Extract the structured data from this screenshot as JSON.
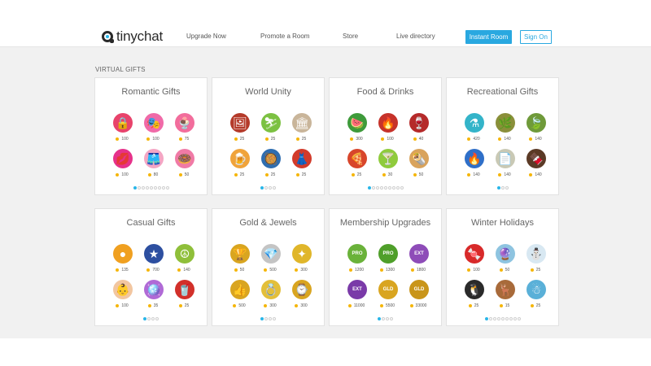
{
  "header": {
    "logo_text": "tinychat",
    "nav": [
      "Upgrade Now",
      "Promote a Room",
      "Store",
      "Live directory"
    ],
    "instant_room": "Instant Room",
    "sign_on": "Sign On"
  },
  "section_title": "VIRTUAL GIFTS",
  "colors": {
    "accent": "#29a8e0",
    "coin": "#f5b60a",
    "background": "#f1f1f1"
  },
  "cards": [
    {
      "title": "Romantic Gifts",
      "dots": 9,
      "active": 0,
      "gifts": [
        {
          "icon": "heart-lock-icon",
          "glyph": "🔒",
          "color": "#e8436b",
          "price": "100"
        },
        {
          "icon": "mask-icon",
          "glyph": "🎭",
          "color": "#f06aa8",
          "price": "100"
        },
        {
          "icon": "sundae-icon",
          "glyph": "🍨",
          "color": "#f26d9c",
          "price": "75"
        },
        {
          "icon": "lips-icon",
          "glyph": "💋",
          "color": "#e6318a",
          "price": "100"
        },
        {
          "icon": "boxers-icon",
          "glyph": "🩳",
          "color": "#f4a6c4",
          "price": "80"
        },
        {
          "icon": "donut-icon",
          "glyph": "🍩",
          "color": "#f07aa6",
          "price": "50"
        }
      ]
    },
    {
      "title": "World Unity",
      "dots": 4,
      "active": 0,
      "gifts": [
        {
          "icon": "portrait-icon",
          "glyph": "🖼",
          "color": "#b43a2a",
          "price": "25"
        },
        {
          "icon": "skier-icon",
          "glyph": "⛷",
          "color": "#7cc142",
          "price": "25"
        },
        {
          "icon": "arch-icon",
          "glyph": "🏛",
          "color": "#c9b59a",
          "price": "25"
        },
        {
          "icon": "beer-icon",
          "glyph": "🍺",
          "color": "#f0a33a",
          "price": "25"
        },
        {
          "icon": "paella-icon",
          "glyph": "🥘",
          "color": "#2e6db0",
          "price": "25"
        },
        {
          "icon": "dress-icon",
          "glyph": "👗",
          "color": "#d23b2b",
          "price": "25"
        }
      ]
    },
    {
      "title": "Food & Drinks",
      "dots": 9,
      "active": 0,
      "gifts": [
        {
          "icon": "watermelon-icon",
          "glyph": "🍉",
          "color": "#3e9a3a",
          "price": "300"
        },
        {
          "icon": "grill-icon",
          "glyph": "🔥",
          "color": "#c6322a",
          "price": "100"
        },
        {
          "icon": "sangria-icon",
          "glyph": "🍷",
          "color": "#b52a2a",
          "price": "40"
        },
        {
          "icon": "pizza-icon",
          "glyph": "🍕",
          "color": "#d8462b",
          "price": "25"
        },
        {
          "icon": "margarita-icon",
          "glyph": "🍸",
          "color": "#8fcb3c",
          "price": "30"
        },
        {
          "icon": "burrito-icon",
          "glyph": "🌯",
          "color": "#d9a35c",
          "price": "50"
        }
      ]
    },
    {
      "title": "Recreational Gifts",
      "dots": 3,
      "active": 0,
      "gifts": [
        {
          "icon": "bong-icon",
          "glyph": "⚗",
          "color": "#34b4c9",
          "price": "420"
        },
        {
          "icon": "herb-bowl-icon",
          "glyph": "🌿",
          "color": "#8a8f3a",
          "price": "140"
        },
        {
          "icon": "joint-icon",
          "glyph": "🍃",
          "color": "#6f9a3a",
          "price": "140"
        },
        {
          "icon": "lighter-icon",
          "glyph": "🔥",
          "color": "#2f6fc8",
          "price": "140"
        },
        {
          "icon": "rolling-papers-icon",
          "glyph": "📄",
          "color": "#c9c9b5",
          "price": "140"
        },
        {
          "icon": "brownies-icon",
          "glyph": "🍫",
          "color": "#5b3a26",
          "price": "140"
        }
      ]
    },
    {
      "title": "Casual Gifts",
      "dots": 4,
      "active": 0,
      "gifts": [
        {
          "icon": "rainbow-ball-icon",
          "glyph": "●",
          "color": "#f0a020",
          "price": "135"
        },
        {
          "icon": "usa-ball-icon",
          "glyph": "★",
          "color": "#2d4fa0",
          "price": "700"
        },
        {
          "icon": "peace-icon",
          "glyph": "☮",
          "color": "#8fbf3a",
          "price": "140"
        },
        {
          "icon": "baby-icon",
          "glyph": "👶",
          "color": "#f2c6a0",
          "price": "100"
        },
        {
          "icon": "disco-ball-icon",
          "glyph": "🪩",
          "color": "#b06ad6",
          "price": "35"
        },
        {
          "icon": "red-cup-icon",
          "glyph": "🥤",
          "color": "#d2302a",
          "price": "25"
        }
      ]
    },
    {
      "title": "Gold & Jewels",
      "dots": 4,
      "active": 0,
      "gifts": [
        {
          "icon": "trophy-icon",
          "glyph": "🏆",
          "color": "#d9a520",
          "price": "50"
        },
        {
          "icon": "diamonds-icon",
          "glyph": "💎",
          "color": "#c4c4c4",
          "price": "500"
        },
        {
          "icon": "necklace-icon",
          "glyph": "✦",
          "color": "#e0b62a",
          "price": "300"
        },
        {
          "icon": "thumbs-up-icon",
          "glyph": "👍",
          "color": "#d9a520",
          "price": "500"
        },
        {
          "icon": "ring-icon",
          "glyph": "💍",
          "color": "#e3bf3a",
          "price": "300"
        },
        {
          "icon": "watch-icon",
          "glyph": "⌚",
          "color": "#d9a520",
          "price": "300"
        }
      ]
    },
    {
      "title": "Membership Upgrades",
      "dots": 4,
      "active": 0,
      "gifts": [
        {
          "icon": "pro-badge-icon",
          "glyph": "PRO",
          "color": "#6ab23a",
          "price": "1200"
        },
        {
          "icon": "pro-badge-icon",
          "glyph": "PRO",
          "color": "#4f9f2a",
          "price": "1300"
        },
        {
          "icon": "extreme-badge-icon",
          "glyph": "EXT",
          "color": "#8e4cb8",
          "price": "1800"
        },
        {
          "icon": "extreme-badge-icon",
          "glyph": "EXT",
          "color": "#7a3aa8",
          "price": "11000"
        },
        {
          "icon": "gold-badge-icon",
          "glyph": "GLD",
          "color": "#d9a520",
          "price": "5500"
        },
        {
          "icon": "gold-badge-icon",
          "glyph": "GLD",
          "color": "#c9951a",
          "price": "33000"
        }
      ]
    },
    {
      "title": "Winter Holidays",
      "dots": 9,
      "active": 0,
      "gifts": [
        {
          "icon": "candy-cane-icon",
          "glyph": "🍬",
          "color": "#d82a2a",
          "price": "100"
        },
        {
          "icon": "snow-globe-icon",
          "glyph": "🔮",
          "color": "#8ec4e0",
          "price": "50"
        },
        {
          "icon": "snowman-icon",
          "glyph": "⛄",
          "color": "#d8e8f2",
          "price": "25"
        },
        {
          "icon": "penguin-icon",
          "glyph": "🐧",
          "color": "#2a2a2a",
          "price": "25"
        },
        {
          "icon": "reindeer-icon",
          "glyph": "🦌",
          "color": "#a86a3a",
          "price": "15"
        },
        {
          "icon": "snowman-globe-icon",
          "glyph": "☃",
          "color": "#5ab0d8",
          "price": "25"
        }
      ]
    }
  ]
}
